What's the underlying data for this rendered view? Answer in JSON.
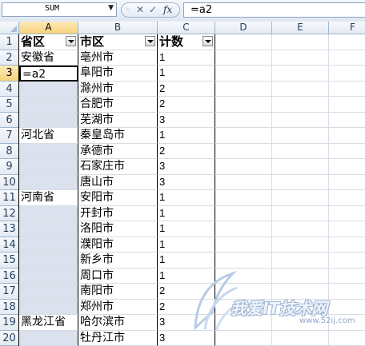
{
  "formula_bar": {
    "name_box": "SUM",
    "cancel_icon": "✕",
    "enter_icon": "✓",
    "fx_label": "fx",
    "formula": "=a2"
  },
  "columns": [
    "A",
    "B",
    "C",
    "D",
    "E",
    "F"
  ],
  "rows": [
    "1",
    "2",
    "3",
    "4",
    "5",
    "6",
    "7",
    "8",
    "9",
    "10",
    "11",
    "12",
    "13",
    "14",
    "15",
    "16",
    "17",
    "18",
    "19",
    "20"
  ],
  "table": {
    "headers": [
      "省区",
      "市区",
      "计数"
    ],
    "province": [
      "安徽省",
      "=a2",
      "",
      "",
      "",
      "河北省",
      "",
      "",
      "",
      "河南省",
      "",
      "",
      "",
      "",
      "",
      "",
      "",
      "黑龙江省",
      ""
    ],
    "city": [
      "亳州市",
      "阜阳市",
      "滁州市",
      "合肥市",
      "芜湖市",
      "秦皇岛市",
      "承德市",
      "石家庄市",
      "唐山市",
      "安阳市",
      "开封市",
      "洛阳市",
      "濮阳市",
      "新乡市",
      "周口市",
      "南阳市",
      "郑州市",
      "哈尔滨市",
      "牡丹江市"
    ],
    "count": [
      "1",
      "1",
      "2",
      "2",
      "3",
      "1",
      "2",
      "3",
      "3",
      "1",
      "1",
      "1",
      "1",
      "1",
      "1",
      "2",
      "2",
      "3",
      "3"
    ]
  },
  "watermark": {
    "text": "我爱IT技术网",
    "url": "www.52ij.com"
  },
  "colors": {
    "selection_header": "#f8d27a",
    "blank_highlight": "#dbe2ee",
    "header_bg": "#e4eaf2"
  }
}
